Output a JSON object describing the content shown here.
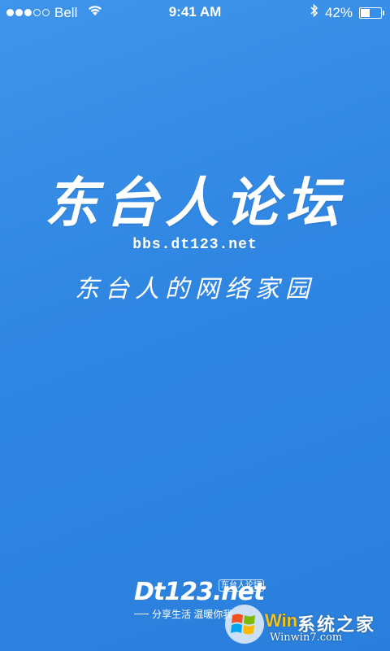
{
  "status_bar": {
    "signal_bars_filled": 3,
    "signal_bars_total": 5,
    "carrier": "Bell",
    "time": "9:41 AM",
    "bluetooth_icon": "bluetooth-icon",
    "battery_percent_label": "42%",
    "battery_level": 0.42
  },
  "splash": {
    "title": "东台人论坛",
    "url": "bbs.dt123.net",
    "slogan": "东台人的网络家园"
  },
  "brand": {
    "logo": "Dt123.net",
    "tag": "东台人论坛",
    "tagline": "分享生活 温暖你我"
  },
  "watermark": {
    "brand_prefix": "Win",
    "brand_cn": "系统之家",
    "url": "Winwin7.com"
  },
  "colors": {
    "background_top": "#3f95ea",
    "background_bottom": "#2a7fdc",
    "text": "#ffffff",
    "watermark_accent": "#f3c21b"
  }
}
